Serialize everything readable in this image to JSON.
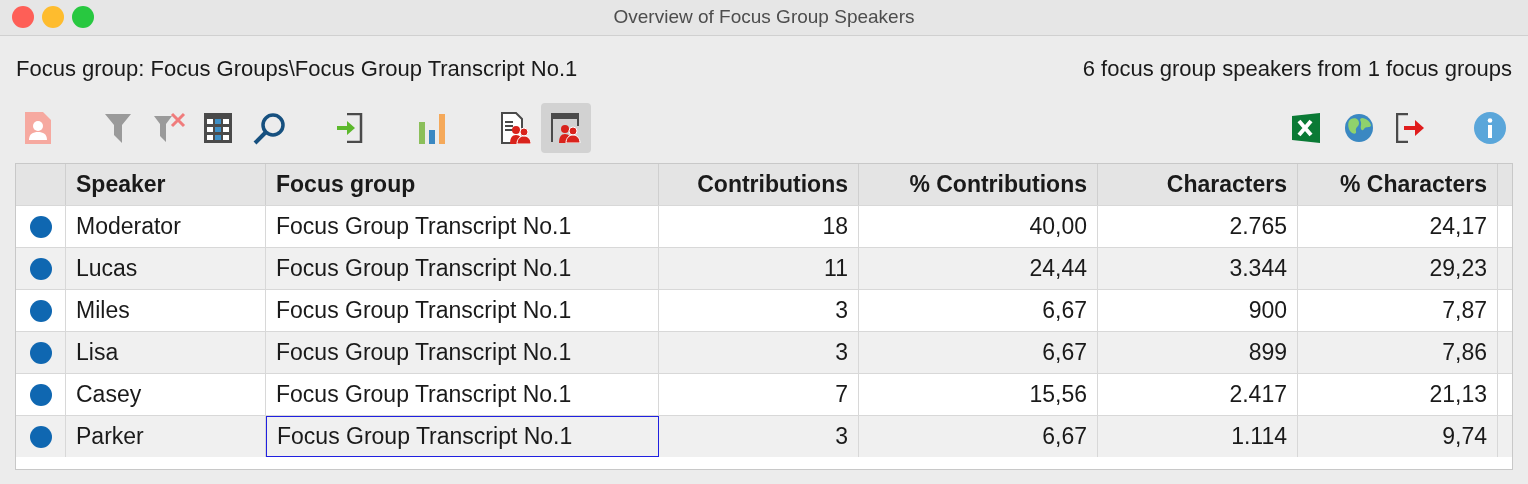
{
  "window": {
    "title": "Overview of Focus Group Speakers"
  },
  "info": {
    "focus_group": "Focus group: Focus Groups\\Focus Group Transcript No.1",
    "summary": "6 focus group speakers from 1 focus groups"
  },
  "toolbar_left": [
    {
      "kind": "person-doc",
      "selected": false
    },
    {
      "kind": "filter",
      "selected": false
    },
    {
      "kind": "filter-clear",
      "selected": false
    },
    {
      "kind": "grid",
      "selected": false
    },
    {
      "kind": "search",
      "selected": false
    },
    {
      "kind": "import",
      "selected": false
    },
    {
      "kind": "chart",
      "selected": false
    },
    {
      "kind": "speakers-doc",
      "selected": false
    },
    {
      "kind": "speakers-window",
      "selected": true
    }
  ],
  "toolbar_right": [
    {
      "kind": "excel"
    },
    {
      "kind": "globe"
    },
    {
      "kind": "export"
    },
    {
      "kind": "info"
    }
  ],
  "table": {
    "columns": [
      "Speaker",
      "Focus group",
      "Contributions",
      "% Contributions",
      "Characters",
      "% Characters"
    ],
    "rows": [
      {
        "color": "#0f67b1",
        "cells": [
          "Moderator",
          "Focus Group Transcript No.1",
          "18",
          "40,00",
          "2.765",
          "24,17"
        ],
        "focused": false
      },
      {
        "color": "#0f67b1",
        "cells": [
          "Lucas",
          "Focus Group Transcript No.1",
          "11",
          "24,44",
          "3.344",
          "29,23"
        ],
        "focused": false
      },
      {
        "color": "#0f67b1",
        "cells": [
          "Miles",
          "Focus Group Transcript No.1",
          "3",
          "6,67",
          "900",
          "7,87"
        ],
        "focused": false
      },
      {
        "color": "#0f67b1",
        "cells": [
          "Lisa",
          "Focus Group Transcript No.1",
          "3",
          "6,67",
          "899",
          "7,86"
        ],
        "focused": false
      },
      {
        "color": "#0f67b1",
        "cells": [
          "Casey",
          "Focus Group Transcript No.1",
          "7",
          "15,56",
          "2.417",
          "21,13"
        ],
        "focused": false
      },
      {
        "color": "#0f67b1",
        "cells": [
          "Parker",
          "Focus Group Transcript No.1",
          "3",
          "6,67",
          "1.114",
          "9,74"
        ],
        "focused": true
      }
    ]
  }
}
